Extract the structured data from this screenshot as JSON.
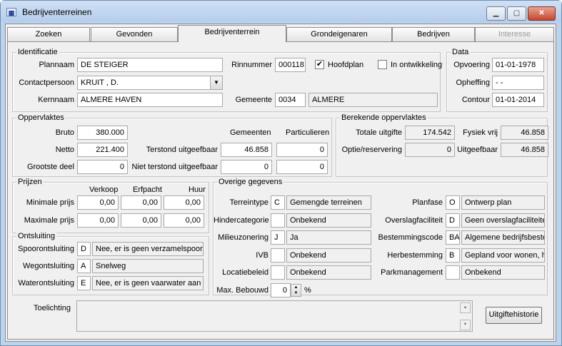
{
  "window": {
    "title": "Bedrijventerreinen",
    "icon": "app-grid-icon",
    "min": "▁",
    "max": "▢",
    "close": "✕"
  },
  "tabs": [
    "Zoeken",
    "Gevonden",
    "Bedrijventerrein",
    "Grondeigenaren",
    "Bedrijven",
    "Interesse"
  ],
  "identificatie": {
    "title": "Identificatie",
    "plannaam_label": "Plannaam",
    "plannaam": "DE STEIGER",
    "contactpersoon_label": "Contactpersoon",
    "contactpersoon": "KRUIT , D.",
    "kernnaam_label": "Kernnaam",
    "kernnaam": "ALMERE HAVEN",
    "rinnummer_label": "Rinnummer",
    "rinnummer": "000118",
    "hoofdplan_label": "Hoofdplan",
    "hoofdplan_checked": true,
    "ontwikkeling_label": "In ontwikkeling",
    "ontwikkeling_checked": false,
    "gemeente_label": "Gemeente",
    "gemeente_code": "0034",
    "gemeente_naam": "ALMERE"
  },
  "data": {
    "title": "Data",
    "opvoering_label": "Opvoering",
    "opvoering": "01-01-1978",
    "opheffing_label": "Opheffing",
    "opheffing": "- -",
    "contour_label": "Contour",
    "contour": "01-01-2014"
  },
  "oppervlaktes": {
    "title": "Oppervlaktes",
    "bruto_label": "Bruto",
    "bruto": "380.000",
    "netto_label": "Netto",
    "netto": "221.400",
    "grootste_label": "Grootste deel",
    "grootste": "0",
    "col_gemeenten": "Gemeenten",
    "col_particulieren": "Particulieren",
    "terstond_label": "Terstond uitgeefbaar",
    "terstond_gem": "46.858",
    "terstond_part": "0",
    "niet_terstond_label": "Niet terstond uitgeefbaar",
    "niet_terstond_gem": "0",
    "niet_terstond_part": "0"
  },
  "berekende": {
    "title": "Berekende oppervlaktes",
    "totale_label": "Totale uitgifte",
    "totale": "174.542",
    "fysiek_label": "Fysiek vrij",
    "fysiek": "46.858",
    "optie_label": "Optie/reservering",
    "optie": "0",
    "uitgeefbaar_label": "Uitgeefbaar",
    "uitgeefbaar": "46.858"
  },
  "prijzen": {
    "title": "Prijzen",
    "col_verkoop": "Verkoop",
    "col_erfpacht": "Erfpacht",
    "col_huur": "Huur",
    "min_label": "Minimale prijs",
    "min_verkoop": "0,00",
    "min_erfpacht": "0,00",
    "min_huur": "0,00",
    "max_label": "Maximale prijs",
    "max_verkoop": "0,00",
    "max_erfpacht": "0,00",
    "max_huur": "0,00"
  },
  "ontsluiting": {
    "title": "Ontsluiting",
    "spoor_label": "Spoorontsluiting",
    "spoor_code": "D",
    "spoor_text": "Nee, er is geen verzamelspoor",
    "weg_label": "Wegontsluiting",
    "weg_code": "A",
    "weg_text": "Snelweg",
    "water_label": "Waterontsluiting",
    "water_code": "E",
    "water_text": "Nee, er is geen vaarwater aan"
  },
  "overige": {
    "title": "Overige gegevens",
    "terreintype_label": "Terreintype",
    "terreintype_code": "C",
    "terreintype_text": "Gemengde terreinen",
    "hinder_label": "Hindercategorie",
    "hinder_code": "",
    "hinder_text": "Onbekend",
    "milieu_label": "Milieuzonering",
    "milieu_code": "J",
    "milieu_text": "Ja",
    "ivb_label": "IVB",
    "ivb_code": "",
    "ivb_text": "Onbekend",
    "locatie_label": "Locatiebeleid",
    "locatie_code": "",
    "locatie_text": "Onbekend",
    "maxbeb_label": "Max. Bebouwd",
    "maxbeb": "0",
    "maxbeb_unit": "%",
    "planfase_label": "Planfase",
    "planfase_code": "O",
    "planfase_text": "Ontwerp plan",
    "overslag_label": "Overslagfaciliteit",
    "overslag_code": "D",
    "overslag_text": "Geen overslagfaciliteiten",
    "bestemming_label": "Bestemmingscode",
    "bestemming_code": "BA",
    "bestemming_text": "Algemene bedrijfsbestemming",
    "herbestemming_label": "Herbestemming",
    "herbestemming_code": "B",
    "herbestemming_text": "Gepland voor wonen, horeca",
    "park_label": "Parkmanagement",
    "park_code": "",
    "park_text": "Onbekend"
  },
  "toelichting": {
    "label": "Toelichting",
    "text": "",
    "scroll_up": "▲",
    "scroll_down": "▼"
  },
  "buttons": {
    "uitgiftehistorie": "Uitgiftehistorie"
  }
}
